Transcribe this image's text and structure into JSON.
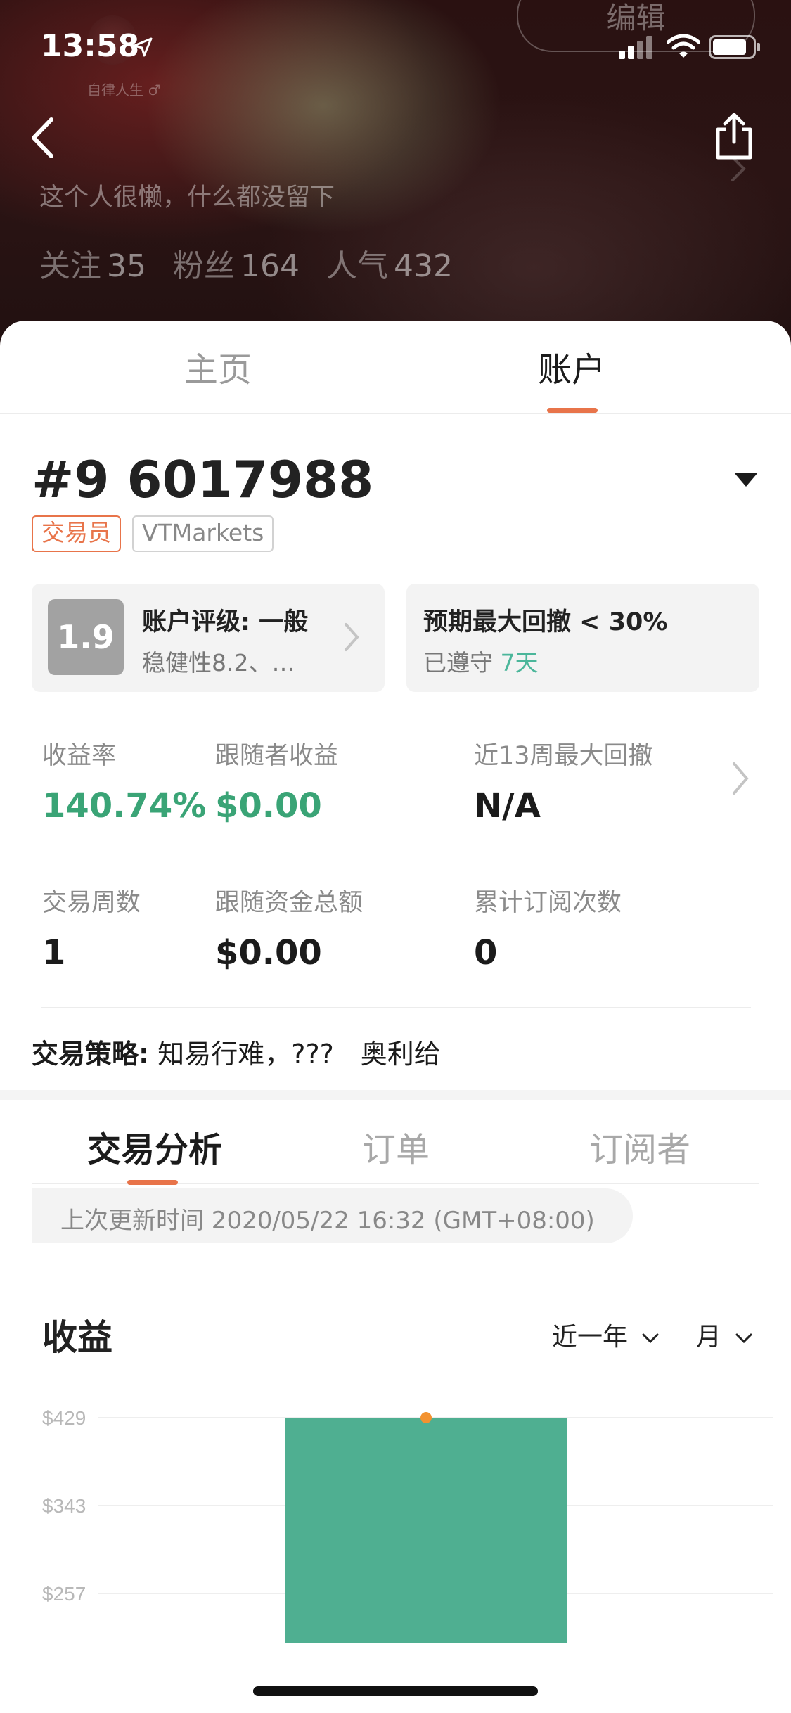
{
  "status_bar": {
    "time": "13:58"
  },
  "header": {
    "edit_label": "编辑",
    "nickname": "自律人生 ♂",
    "bio": "这个人很懒，什么都没留下",
    "following_label": "关注",
    "following_count": "35",
    "followers_label": "粉丝",
    "followers_count": "164",
    "popularity_label": "人气",
    "popularity_count": "432"
  },
  "tabs": {
    "home": "主页",
    "account": "账户"
  },
  "account": {
    "id": "#9 6017988",
    "badge_trader": "交易员",
    "badge_broker": "VTMarkets",
    "rating": {
      "score": "1.9",
      "title": "账户评级: 一般",
      "subtitle": "稳健性8.2、…"
    },
    "drawdown": {
      "title": "预期最大回撤 < 30%",
      "subtitle_prefix": "已遵守",
      "subtitle_value": "7天"
    },
    "metrics": [
      {
        "label": "收益率",
        "value": "140.74%",
        "color": "#3aa476"
      },
      {
        "label": "跟随者收益",
        "value": "$0.00",
        "color": "#3aa476"
      },
      {
        "label": "近13周最大回撤",
        "value": "N/A",
        "color": "#1b1b1b"
      },
      {
        "label": "交易周数",
        "value": "1",
        "color": "#1b1b1b"
      },
      {
        "label": "跟随资金总额",
        "value": "$0.00",
        "color": "#1b1b1b"
      },
      {
        "label": "累计订阅次数",
        "value": "0",
        "color": "#1b1b1b"
      }
    ],
    "strategy_label": "交易策略:",
    "strategy_text": "知易行难，???　奥利给"
  },
  "sub_tabs": [
    "交易分析",
    "订单",
    "订阅者"
  ],
  "last_update": "上次更新时间 2020/05/22 16:32 (GMT+08:00)",
  "chart_section": {
    "title": "收益",
    "range_label": "近一年",
    "period_label": "月"
  },
  "chart_data": {
    "type": "bar",
    "title": "收益",
    "categories": [
      ""
    ],
    "values": [
      429
    ],
    "ylim": [
      257,
      429
    ],
    "y_ticks": [
      "$429",
      "$343",
      "$257"
    ],
    "y_tick_values": [
      429,
      343,
      257
    ],
    "bar_color": "#4faf91",
    "marker_color": "#f3922f",
    "grid": true
  },
  "colors": {
    "accent": "#e8744a",
    "positive": "#3aa476",
    "bar": "#4faf91"
  }
}
